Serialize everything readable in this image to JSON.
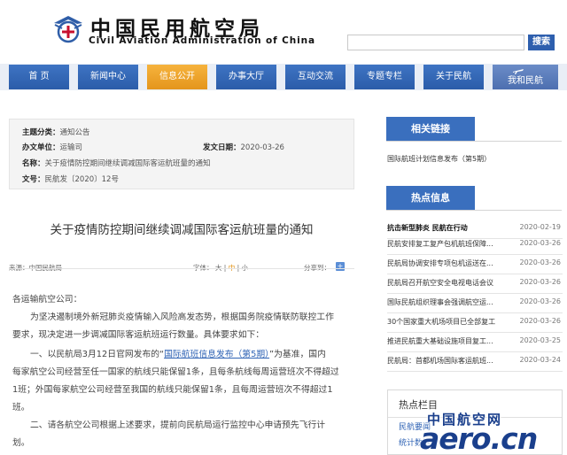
{
  "header": {
    "brand_cn": "中国民用航空局",
    "brand_en": "Civil Aviation Administration of China",
    "search_placeholder": "",
    "search_button": "搜索"
  },
  "nav": {
    "items": [
      "首 页",
      "新闻中心",
      "信息公开",
      "办事大厅",
      "互动交流",
      "专题专栏",
      "关于民航",
      "我和民航"
    ],
    "active": "信息公开"
  },
  "info": {
    "category_label": "主题分类：",
    "category": "通知公告",
    "office_label": "办文单位：",
    "office": "运输司",
    "date_label": "发文日期：",
    "date": "2020-03-26",
    "name_label": "名称：",
    "name": "关于疫情防控期间继续调减国际客运航班量的通知",
    "docno_label": "文号：",
    "docno": "民航发〔2020〕12号"
  },
  "article": {
    "title": "关于疫情防控期间继续调减国际客运航班量的通知",
    "source": "来源：中国民航局",
    "font_label": "字体：",
    "font_large": "大",
    "font_mid": "中",
    "font_small": "小",
    "share_label": "分享到：",
    "salutation": "各运输航空公司：",
    "p1a": "为坚决遏制境外新冠肺炎疫情输入风险高发态势，根据国务院疫情联防联控工作",
    "p1b": "要求，现决定进一步调减国际客运航班运行数量。具体要求如下：",
    "p2_prefix": "一、以民航局3月12日官网发布的“",
    "p2_link": "国际航班信息发布（第5期）",
    "p2_suffix": "”为基准，国内",
    "p2b": "每家航空公司经营至任一国家的航线只能保留1条，且每条航线每周运营班次不得超过",
    "p2c": "1班；外国每家航空公司经营至我国的航线只能保留1条，且每周运营班次不得超过1",
    "p2d": "班。",
    "p3a": "二、请各航空公司根据上述要求，提前向民航局运行监控中心申请预先飞行计",
    "p3b": "划。"
  },
  "sidebar": {
    "links_title": "相关链接",
    "links": [
      "国际航班计划信息发布（第5期）"
    ],
    "hot_title": "热点信息",
    "hot": [
      {
        "title": "抗击新型肺炎 民航在行动",
        "date": "2020-02-19"
      },
      {
        "title": "民航安排复工复产包机航班保障...",
        "date": "2020-03-26"
      },
      {
        "title": "民航局协调安排专项包机运送在...",
        "date": "2020-03-26"
      },
      {
        "title": "民航局召开航空安全电视电话会议",
        "date": "2020-03-26"
      },
      {
        "title": "国际民航组织理事会强调航空运...",
        "date": "2020-03-26"
      },
      {
        "title": "30个国家重大机场项目已全部复工",
        "date": "2020-03-26"
      },
      {
        "title": "推进民航重大基础设施项目复工...",
        "date": "2020-03-25"
      },
      {
        "title": "民航局：首都机场国际客运航班...",
        "date": "2020-03-24"
      }
    ],
    "hotbar_title": "热点栏目",
    "hotbar_items": [
      "民航要闻",
      "统计数据"
    ]
  },
  "watermark": {
    "cn": "中国航空网",
    "en": "aero.cn"
  },
  "colors": {
    "nav_blue": "#2b5ca9",
    "nav_active": "#e4951c",
    "link": "#2f63b5",
    "side_head": "#3a6fbe"
  }
}
